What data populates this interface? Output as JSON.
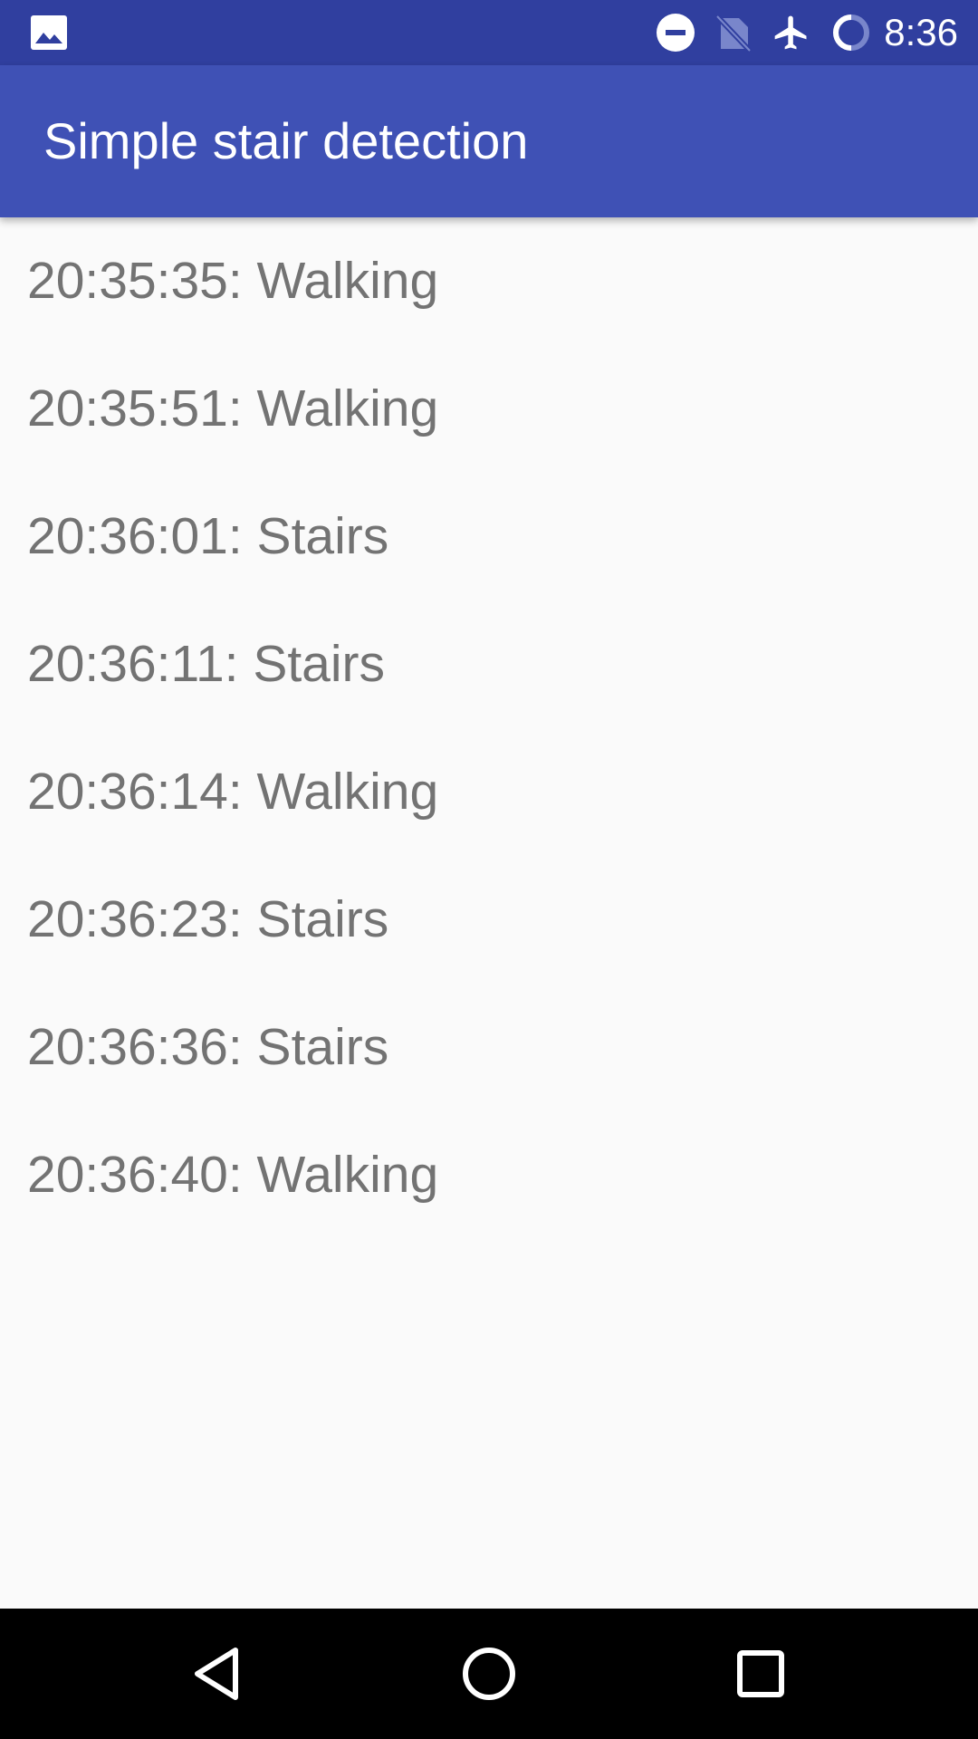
{
  "status_bar": {
    "time": "8:36",
    "icons": [
      "image-notification-icon",
      "do-not-disturb-icon",
      "no-sim-icon",
      "airplane-mode-icon",
      "battery-charging-icon"
    ]
  },
  "app_bar": {
    "title": "Simple stair detection"
  },
  "log": {
    "items": [
      {
        "text": "20:35:35: Walking"
      },
      {
        "text": "20:35:51: Walking"
      },
      {
        "text": "20:36:01: Stairs"
      },
      {
        "text": "20:36:11: Stairs"
      },
      {
        "text": "20:36:14: Walking"
      },
      {
        "text": "20:36:23: Stairs"
      },
      {
        "text": "20:36:36: Stairs"
      },
      {
        "text": "20:36:40: Walking"
      }
    ]
  },
  "nav_bar": {
    "buttons": [
      "back-icon",
      "home-icon",
      "recents-icon"
    ]
  },
  "colors": {
    "status_bar": "#303f9f",
    "app_bar": "#3f51b5",
    "background": "#fafafa",
    "list_text": "#737373",
    "nav_bar": "#000000"
  }
}
